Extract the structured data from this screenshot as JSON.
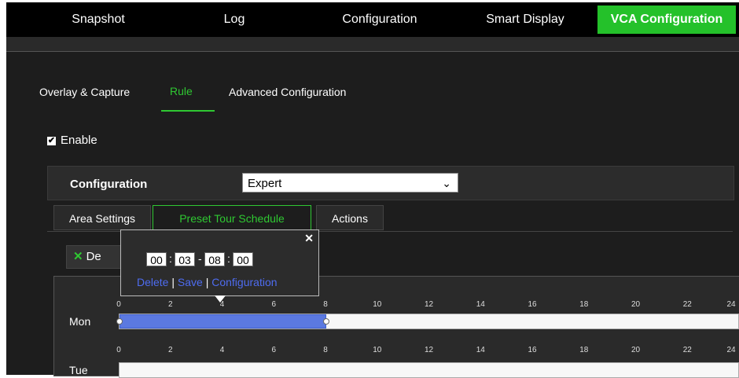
{
  "top_nav": {
    "tabs": [
      {
        "label": "Snapshot",
        "active": false
      },
      {
        "label": "Log",
        "active": false
      },
      {
        "label": "Configuration",
        "active": false
      },
      {
        "label": "Smart Display",
        "active": false
      },
      {
        "label": "VCA Configuration",
        "active": true
      }
    ]
  },
  "sub_tabs": [
    {
      "label": "Overlay & Capture",
      "active": false
    },
    {
      "label": "Rule",
      "active": true
    },
    {
      "label": "Advanced Configuration",
      "active": false
    }
  ],
  "enable": {
    "label": "Enable",
    "checked": true,
    "check_glyph": "✔"
  },
  "config": {
    "label": "Configuration",
    "value": "Expert",
    "chevron": "⌄"
  },
  "panel_tabs": [
    {
      "label": "Area Settings",
      "active": false
    },
    {
      "label": "Preset Tour Schedule",
      "active": true
    },
    {
      "label": "Actions",
      "active": false
    }
  ],
  "delete_button": {
    "label": "De",
    "icon": "✕"
  },
  "popup": {
    "close": "✕",
    "hour_start": "00",
    "min_start": "03",
    "hour_end": "08",
    "min_end": "00",
    "colon": ":",
    "dash": "-",
    "link_delete": "Delete",
    "link_save": "Save",
    "link_config": "Configuration",
    "separator": "|"
  },
  "schedule": {
    "ticks": [
      "0",
      "2",
      "4",
      "6",
      "8",
      "10",
      "12",
      "14",
      "16",
      "18",
      "20",
      "22",
      "24"
    ],
    "days": [
      {
        "label": "Mon",
        "segment_start_hour": 0,
        "segment_end_hour": 8
      },
      {
        "label": "Tue"
      }
    ]
  },
  "colors": {
    "accent_green": "#24c12a",
    "segment_blue": "#5b79e0",
    "link_blue": "#4e6cf0"
  }
}
